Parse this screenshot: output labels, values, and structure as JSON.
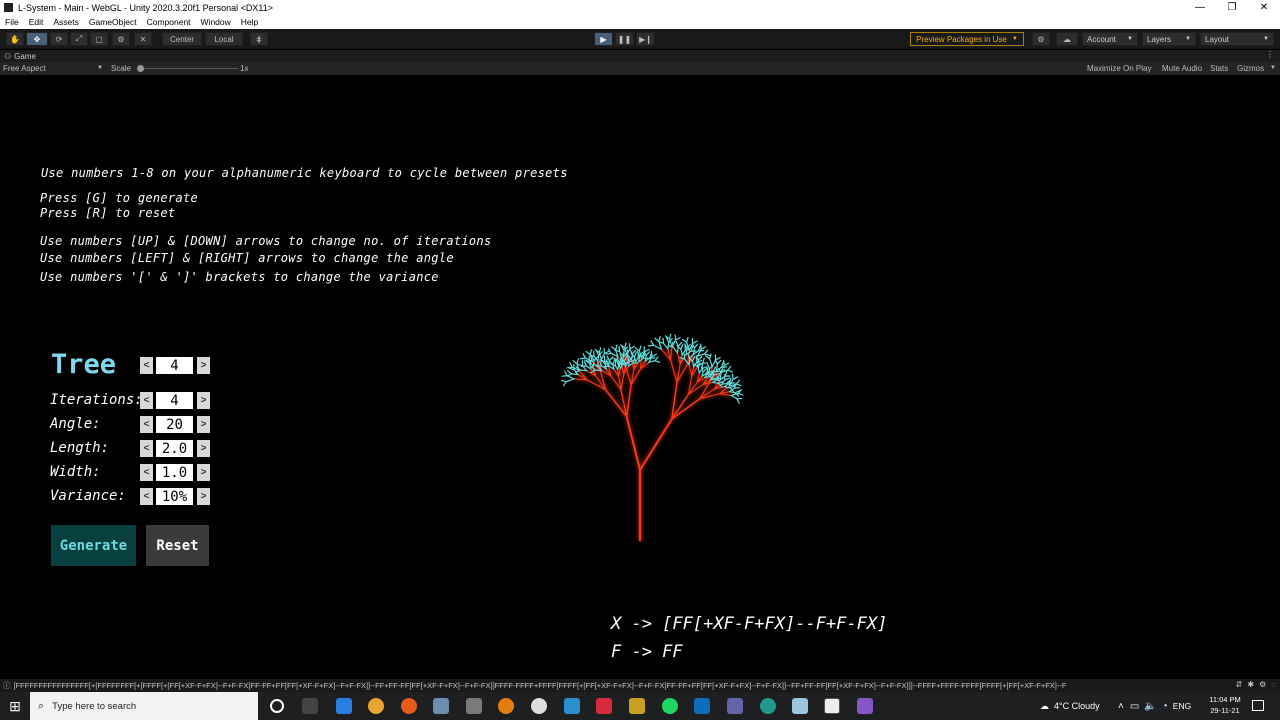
{
  "window": {
    "title": "L-System - Main - WebGL - Unity 2020.3.20f1 Personal <DX11>",
    "controls": [
      "—",
      "❐",
      "✕"
    ]
  },
  "menu": [
    "File",
    "Edit",
    "Assets",
    "GameObject",
    "Component",
    "Window",
    "Help"
  ],
  "toolbar": {
    "tools": [
      "✋",
      "✥",
      "⟳",
      "⤢",
      "▢",
      "⚙",
      "✕"
    ],
    "pivot": "Center",
    "space": "Local",
    "grid_icon": "⋕",
    "play": "▶",
    "pause": "❚❚",
    "step": "▶❙",
    "preview_packages": "Preview Packages in Use",
    "account": "Account",
    "layers": "Layers",
    "layout": "Layout"
  },
  "game_tab": {
    "label": "Game"
  },
  "game_bar": {
    "aspect": "Free Aspect",
    "scale_label": "Scale",
    "scale_value": "1x",
    "maximize": "Maximize On Play",
    "mute": "Mute Audio",
    "stats": "Stats",
    "gizmos": "Gizmos"
  },
  "instructions": {
    "line1": "Use numbers 1-8 on your alphanumeric keyboard to cycle between presets",
    "line2": "Press [G] to generate",
    "line3": "Press [R] to reset",
    "line4": "Use numbers [UP] & [DOWN] arrows to change no. of iterations",
    "line5": "Use numbers [LEFT] & [RIGHT] arrows to change the angle",
    "line6": "Use numbers '[' & ']' brackets to change the variance"
  },
  "preset": {
    "label": "Tree",
    "value": "4"
  },
  "params": [
    {
      "label": "Iterations:",
      "value": "4"
    },
    {
      "label": "Angle:",
      "value": "20"
    },
    {
      "label": "Length:",
      "value": "2.0"
    },
    {
      "label": "Width:",
      "value": "1.0"
    },
    {
      "label": "Variance:",
      "value": "10%"
    }
  ],
  "arrows": {
    "left": "<",
    "right": ">"
  },
  "buttons": {
    "generate": "Generate",
    "reset": "Reset"
  },
  "rules": {
    "x_rule": "X -> [FF[+XF-F+FX]--F+F-FX]",
    "f_rule": "F -> FF"
  },
  "colors": {
    "branch": "#ff3a1a",
    "leaf": "#5fe0e0",
    "tree_label": "#7ed8f0",
    "generate_bg": "#083f3f"
  },
  "status": {
    "text": "[FFFFFFFFFFFFFFFF[+[FFFFFFFF[+[FFFF[+[FF[+XF-F+FX]--F+F-FX]FF-FF+FF[FF[+XF-F+FX]--F+F-FX]]--FF+FF-FF[FF[+XF-F+FX]--F+F-FX]]FFFF-FFFF+FFFF[FFFF[+[FF[+XF-F+FX]--F+F-FX]FF-FF+FF[FF[+XF-F+FX]--F+F-FX]]--FF+FF-FF[FF[+XF-F+FX]--F+F-FX]]]--FFFF+FFFF-FFFF[FFFF[+[FF[+XF-F+FX]--F"
  },
  "taskbar": {
    "search_placeholder": "Type here to search",
    "weather": "4°C Cloudy",
    "lang": "ENG",
    "time": "11:04 PM",
    "date": "29-11-21"
  }
}
